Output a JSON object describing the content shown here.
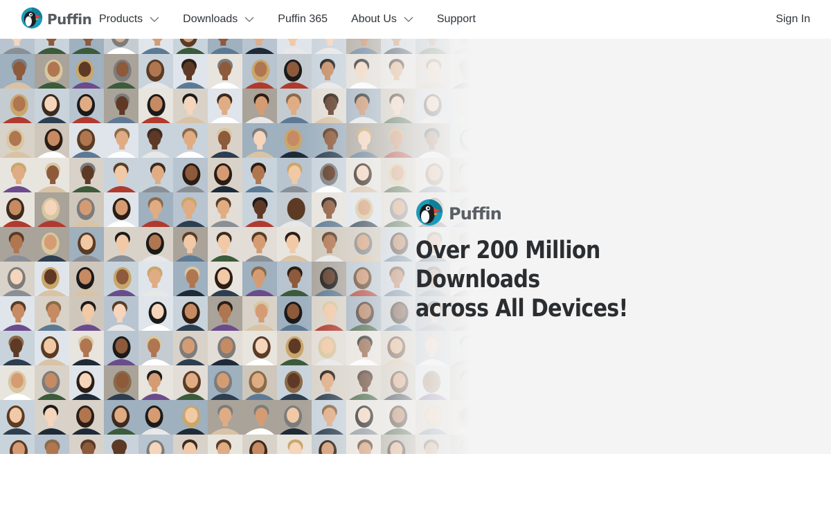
{
  "header": {
    "brand_name": "Puffin",
    "nav": [
      {
        "label": "Products",
        "has_dropdown": true
      },
      {
        "label": "Downloads",
        "has_dropdown": true
      },
      {
        "label": "Puffin 365",
        "has_dropdown": false
      },
      {
        "label": "About Us",
        "has_dropdown": true
      },
      {
        "label": "Support",
        "has_dropdown": false
      }
    ],
    "signin_label": "Sign In"
  },
  "hero": {
    "brand_name": "Puffin",
    "headline_line1": "Over 200 Million Downloads",
    "headline_line2": "across All Devices!",
    "background_image": "portrait-mosaic"
  },
  "icons": {
    "logo": "puffin-bird-logo-icon",
    "dropdown": "chevron-down-icon"
  },
  "colors": {
    "hero_background": "#f4f4f4",
    "text_dark": "#2b2e31",
    "brand_gray": "#555b61",
    "logo_teal": "#1b9bb8",
    "logo_beak": "#e0463a"
  }
}
